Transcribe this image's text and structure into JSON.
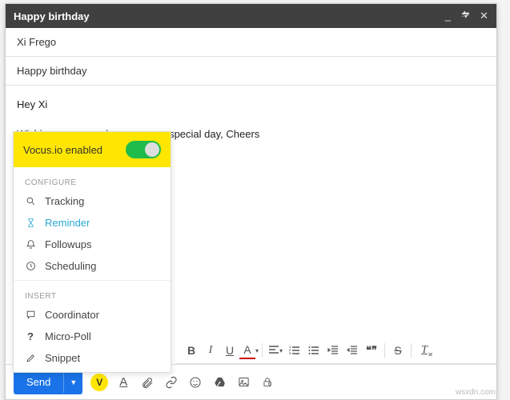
{
  "header": {
    "title": "Happy birthday"
  },
  "to": "Xi Frego",
  "subject": "Happy birthday",
  "body": {
    "greeting": "Hey Xi",
    "line1": "Wishing you a good one on your special day, Cheers"
  },
  "vocus": {
    "title": "Vocus.io enabled",
    "section_configure": "CONFIGURE",
    "section_insert": "INSERT",
    "items_configure": {
      "tracking": "Tracking",
      "reminder": "Reminder",
      "followups": "Followups",
      "scheduling": "Scheduling"
    },
    "items_insert": {
      "coordinator": "Coordinator",
      "micropoll": "Micro-Poll",
      "snippet": "Snippet"
    }
  },
  "send": {
    "label": "Send"
  },
  "format": {
    "bold": "B",
    "italic": "I",
    "underline": "U",
    "color": "A",
    "quote": "❝❞"
  },
  "toolbar_vocus": "V",
  "question": "?",
  "watermark": "wsxdn.com"
}
